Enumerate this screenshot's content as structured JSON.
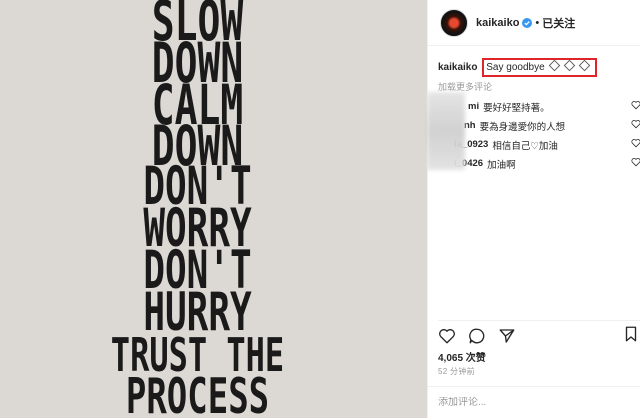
{
  "poster": {
    "lines": [
      "SLOW",
      "DOWN",
      "CALM",
      "DOWN",
      "DON'T",
      "WORRY",
      "DON'T",
      "HURRY",
      "TRUST THE",
      "PROCESS"
    ]
  },
  "header": {
    "username": "kaikaiko",
    "dot": "•",
    "follow_state": "已关注"
  },
  "caption": {
    "username": "kaikaiko",
    "text": "Say goodbye"
  },
  "load_more": "加载更多评论",
  "comments": [
    {
      "user": "mi",
      "text": "要好好堅持著。"
    },
    {
      "user": "nh",
      "text": "要為身邊愛你的人想"
    },
    {
      "user": "ia_0923",
      "text": "相信自己♡加油"
    },
    {
      "user": "i_0426",
      "text": "加油啊"
    }
  ],
  "likes": "4,065 次赞",
  "time": "52 分钟前",
  "add_comment_placeholder": "添加评论...",
  "colors": {
    "highlight_border": "#e0242a",
    "verified": "#3897f0",
    "photo_bg": "#dcd8d3"
  }
}
